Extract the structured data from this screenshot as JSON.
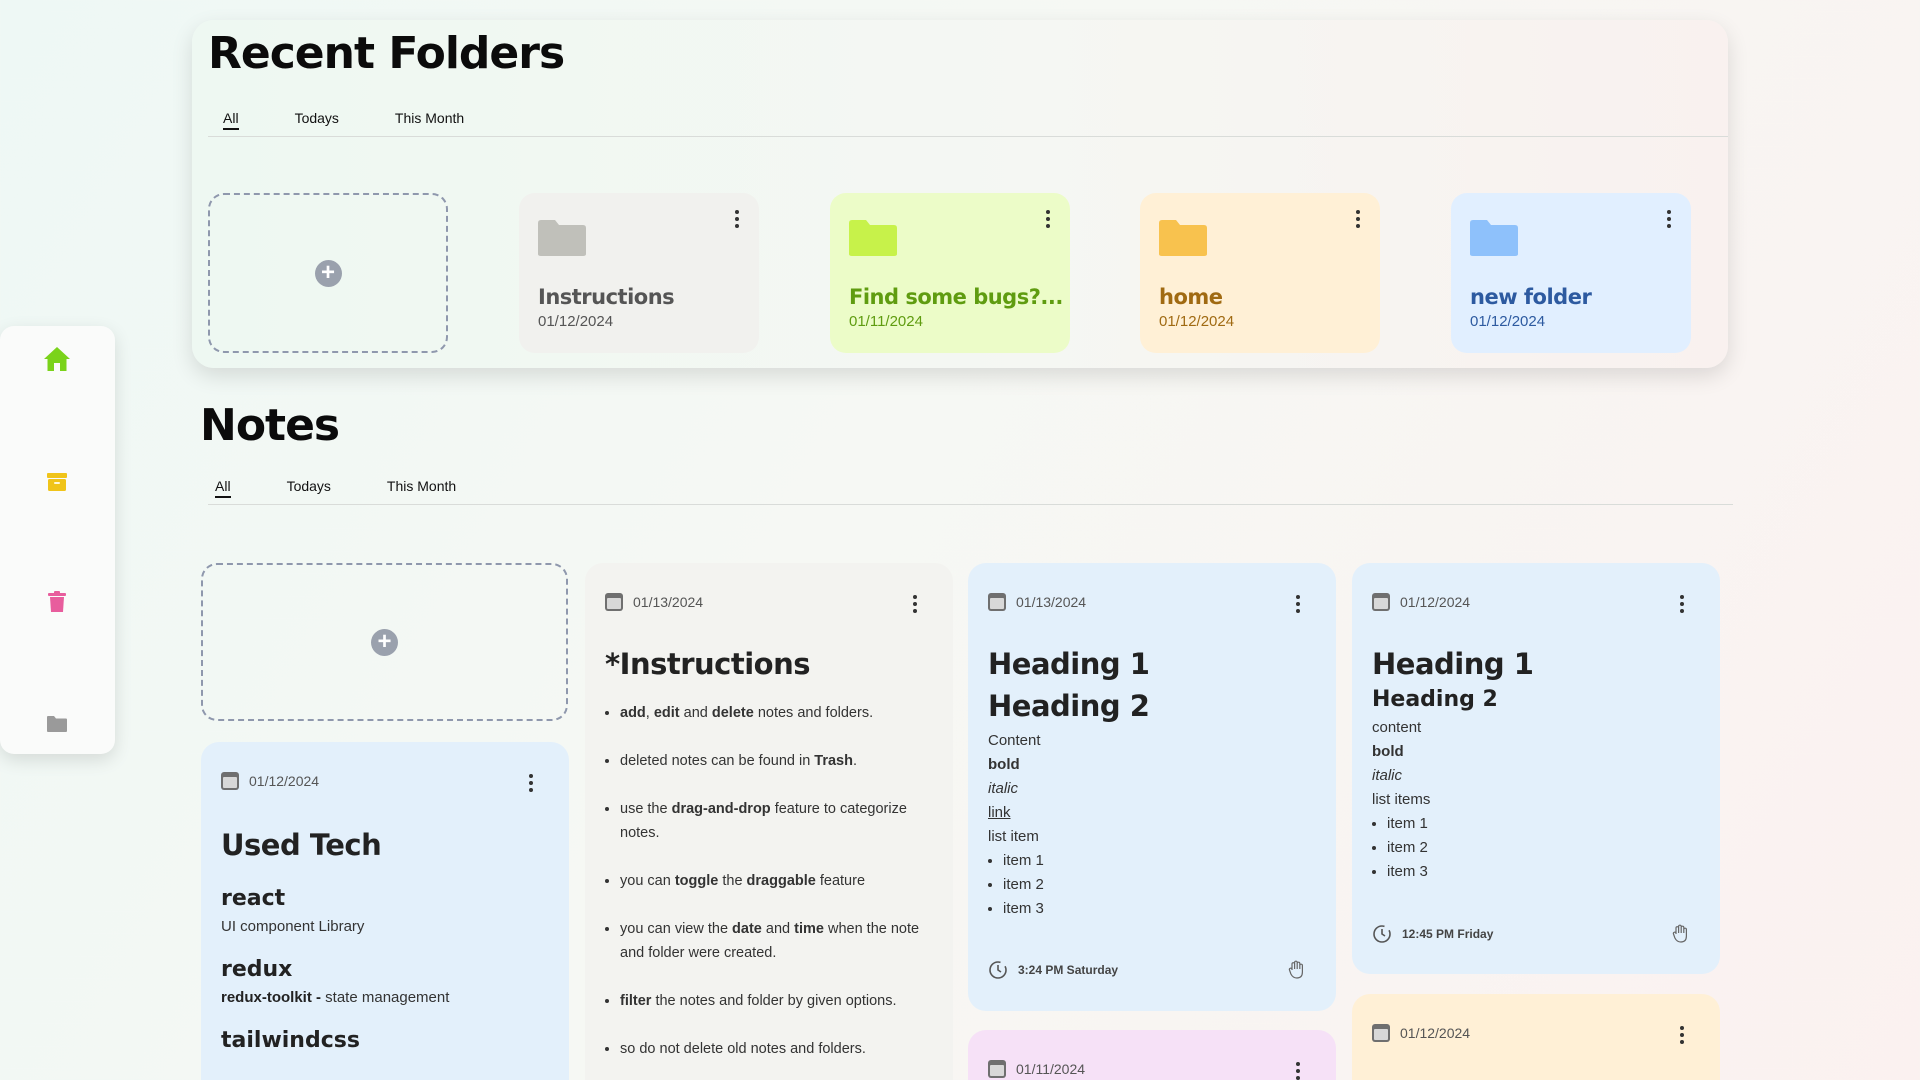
{
  "colors": {
    "accent_home": "#7ad31a",
    "archive": "#f0c419",
    "trash": "#e85d9d",
    "folder_gray": "#9a9a9a"
  },
  "sidebar": {
    "items": [
      {
        "name": "home",
        "icon": "home-icon"
      },
      {
        "name": "archive",
        "icon": "archive-icon"
      },
      {
        "name": "trash",
        "icon": "trash-icon"
      },
      {
        "name": "folders",
        "icon": "folder-icon"
      }
    ]
  },
  "folders_section": {
    "title": "Recent Folders",
    "tabs": [
      "All",
      "Todays",
      "This Month"
    ],
    "folders": [
      {
        "name": "Instructions",
        "date": "01/12/2024",
        "bg": "#f1f1ee",
        "icon_color": "#c0c0ba",
        "text_color": "#555555"
      },
      {
        "name": "Find some bugs?...",
        "date": "01/11/2024",
        "bg": "#ecfcc8",
        "icon_color": "#c7f24a",
        "text_color": "#5f9c10"
      },
      {
        "name": "home",
        "date": "01/12/2024",
        "bg": "#fff0d6",
        "icon_color": "#f8c24e",
        "text_color": "#a06a12"
      },
      {
        "name": "new folder",
        "date": "01/12/2024",
        "bg": "#e1efff",
        "icon_color": "#8ec1fb",
        "text_color": "#2d5aa0"
      }
    ]
  },
  "notes_section": {
    "title": "Notes",
    "tabs": [
      "All",
      "Todays",
      "This Month"
    ]
  },
  "notes": {
    "used_tech": {
      "date": "01/12/2024",
      "title": "Used Tech",
      "items": [
        {
          "name": "react",
          "desc_bold": "",
          "desc": "UI component Library"
        },
        {
          "name": "redux",
          "desc_bold": "redux-toolkit -",
          "desc": " state management"
        },
        {
          "name": "tailwindcss",
          "desc_bold": "",
          "desc": ""
        }
      ]
    },
    "instructions": {
      "date": "01/13/2024",
      "title": "*Instructions"
    },
    "note_a": {
      "date": "01/13/2024",
      "h1": "Heading 1",
      "h2": "Heading 2",
      "content": "Content",
      "bold": "bold",
      "italic": "italic",
      "link": "link",
      "list_label": "list item",
      "items": [
        "item 1",
        "item 2",
        "item 3"
      ],
      "time": "3:24 PM Saturday"
    },
    "note_b": {
      "date": "01/12/2024",
      "h1": "Heading 1",
      "h2": "Heading 2",
      "content": "content",
      "bold": "bold",
      "italic": "italic",
      "list_label": "list items",
      "items": [
        "item 1",
        "item 2",
        "item 3"
      ],
      "time": "12:45 PM Friday"
    },
    "note_c": {
      "date": "01/11/2024"
    },
    "note_d": {
      "date": "01/12/2024"
    }
  }
}
